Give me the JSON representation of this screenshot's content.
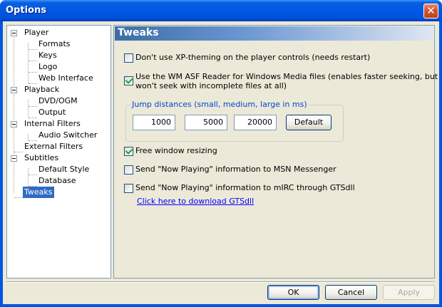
{
  "window": {
    "title": "Options"
  },
  "tree": {
    "items": [
      {
        "label": "Player",
        "expanded": true
      },
      {
        "label": "Formats"
      },
      {
        "label": "Keys"
      },
      {
        "label": "Logo"
      },
      {
        "label": "Web Interface"
      },
      {
        "label": "Playback",
        "expanded": true
      },
      {
        "label": "DVD/OGM"
      },
      {
        "label": "Output"
      },
      {
        "label": "Internal Filters",
        "expanded": true
      },
      {
        "label": "Audio Switcher"
      },
      {
        "label": "External Filters"
      },
      {
        "label": "Subtitles",
        "expanded": true
      },
      {
        "label": "Default Style"
      },
      {
        "label": "Database"
      },
      {
        "label": "Tweaks",
        "selected": true
      }
    ]
  },
  "panel": {
    "title": "Tweaks",
    "options": {
      "xp_theming": {
        "label": "Don't use XP-theming on the player controls (needs restart)",
        "checked": false
      },
      "wm_asf_line1": "Use the WM ASF Reader for Windows Media files (enables faster seeking, but",
      "wm_asf_line2": "won't seek with incomplete files at all)",
      "wm_asf_checked": true,
      "free_resize": {
        "label": "Free window resizing",
        "checked": true
      },
      "msn": {
        "label": "Send \"Now Playing\" information to MSN Messenger",
        "checked": false
      },
      "mirc": {
        "label": "Send \"Now Playing\" information to mIRC through GTSdll",
        "checked": false
      }
    },
    "jump": {
      "caption": "Jump distances (small, medium, large in ms)",
      "small": "1000",
      "medium": "5000",
      "large": "20000",
      "default_label": "Default"
    },
    "download_link": "Click here to download GTSdll"
  },
  "buttons": {
    "ok": "OK",
    "cancel": "Cancel",
    "apply": "Apply"
  }
}
